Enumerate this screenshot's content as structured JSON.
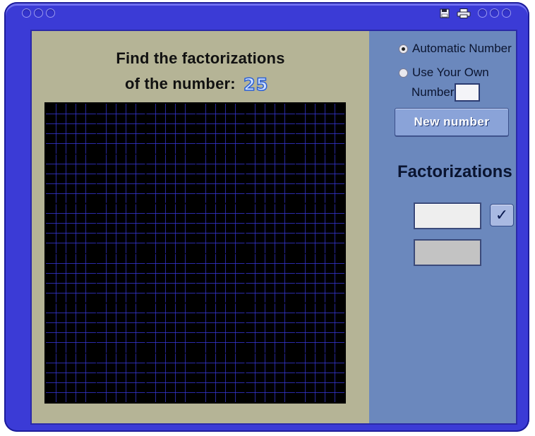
{
  "window": {
    "toolbar_icons": [
      "save-icon",
      "print-icon"
    ]
  },
  "prompt": {
    "line1": "Find the factorizations",
    "line2": "of the number:",
    "number": "25"
  },
  "options": {
    "automatic_label": "Automatic Number",
    "own_label_line1": "Use Your Own",
    "own_label_line2": "Number",
    "own_value": "",
    "selected": "automatic"
  },
  "new_number_button": "New number",
  "factorizations": {
    "title": "Factorizations",
    "input_value": "",
    "check_glyph": "✓"
  },
  "grid": {
    "minor_cells": 30,
    "major_every": 10,
    "mid_every": 5,
    "minor_color": "#3a3ae0",
    "major_color": "#000000"
  }
}
